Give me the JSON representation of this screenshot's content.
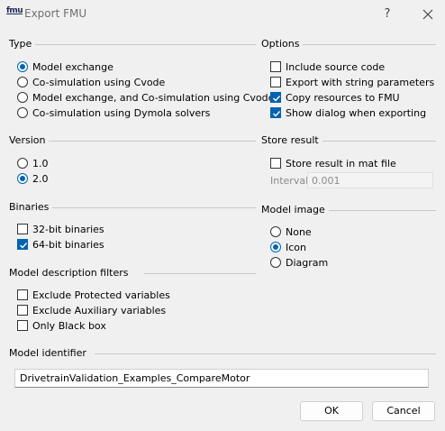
{
  "window": {
    "icon_text": "fmu",
    "title": "Export FMU",
    "help": "?"
  },
  "type_group": {
    "title": "Type",
    "options": [
      {
        "label": "Model exchange",
        "checked": true
      },
      {
        "label": "Co-simulation using Cvode",
        "checked": false
      },
      {
        "label": "Model exchange, and Co-simulation using Cvode",
        "checked": false
      },
      {
        "label": "Co-simulation using Dymola solvers",
        "checked": false
      }
    ]
  },
  "options_group": {
    "title": "Options",
    "options": [
      {
        "label": "Include source code",
        "checked": false
      },
      {
        "label": "Export with string parameters",
        "checked": false
      },
      {
        "label": "Copy resources to FMU",
        "checked": true
      },
      {
        "label": "Show dialog when exporting",
        "checked": true
      }
    ]
  },
  "version_group": {
    "title": "Version",
    "options": [
      {
        "label": "1.0",
        "checked": false
      },
      {
        "label": "2.0",
        "checked": true
      }
    ]
  },
  "store_group": {
    "title": "Store result",
    "store_label": "Store result in mat file",
    "store_checked": false,
    "interval_label": "Interval",
    "interval_value": "0.001"
  },
  "binaries_group": {
    "title": "Binaries",
    "options": [
      {
        "label": "32-bit binaries",
        "checked": false
      },
      {
        "label": "64-bit binaries",
        "checked": true
      }
    ]
  },
  "image_group": {
    "title": "Model image",
    "options": [
      {
        "label": "None",
        "checked": false
      },
      {
        "label": "Icon",
        "checked": true
      },
      {
        "label": "Diagram",
        "checked": false
      }
    ]
  },
  "filters_group": {
    "title": "Model description filters",
    "options": [
      {
        "label": "Exclude Protected variables",
        "checked": false
      },
      {
        "label": "Exclude Auxiliary variables",
        "checked": false
      },
      {
        "label": "Only Black box",
        "checked": false
      }
    ]
  },
  "identifier_group": {
    "title": "Model identifier",
    "value": "DrivetrainValidation_Examples_CompareMotor"
  },
  "buttons": {
    "ok": "OK",
    "cancel": "Cancel"
  },
  "colors": {
    "accent": "#0063b1",
    "background": "#f0f0f0"
  }
}
